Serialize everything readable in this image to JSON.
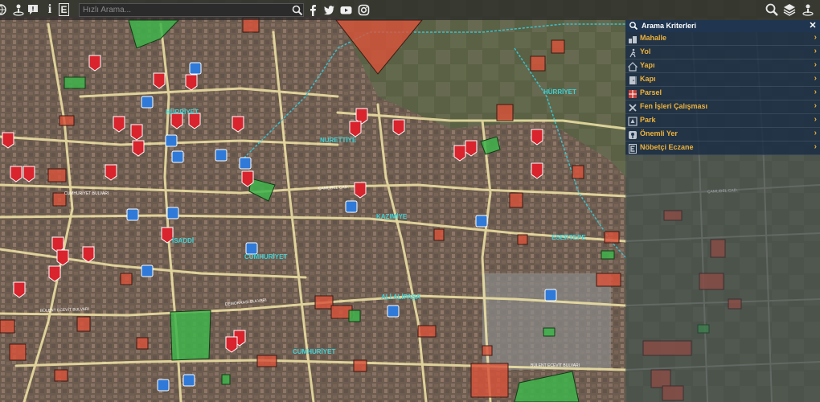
{
  "toolbar": {
    "icons": [
      "globe-icon",
      "location-pin-icon",
      "comment-icon",
      "info-icon",
      "pharmacy-e-icon"
    ],
    "info_glyph": "i",
    "pharmacy_glyph": "E",
    "search_placeholder": "Hızlı Arama...",
    "social": [
      "facebook-icon",
      "twitter-icon",
      "youtube-icon",
      "instagram-icon"
    ],
    "right_icons": [
      "search-zoom-icon",
      "layers-icon",
      "location-pin-icon"
    ]
  },
  "panel": {
    "title": "Arama Kriterleri",
    "items": [
      {
        "label": "Mahalle",
        "icon": "neighborhood-icon"
      },
      {
        "label": "Yol",
        "icon": "walker-icon"
      },
      {
        "label": "Yapı",
        "icon": "house-icon"
      },
      {
        "label": "Kapı",
        "icon": "door-icon"
      },
      {
        "label": "Parsel",
        "icon": "parcel-icon"
      },
      {
        "label": "Fen İşleri Çalışması",
        "icon": "tools-icon"
      },
      {
        "label": "Park",
        "icon": "park-icon"
      },
      {
        "label": "Önemli Yer",
        "icon": "important-place-icon"
      },
      {
        "label": "Nöbetçi Eczane",
        "icon": "pharmacy-icon"
      }
    ]
  },
  "map": {
    "neighborhoods": [
      "HÜRRİYET",
      "NURETTİYE",
      "KAZIMİYE",
      "ESERTEPE",
      "HÜRRİYET",
      "ALİ ALİPAŞA",
      "CUMHURİYET",
      "İSADDİ",
      "CUMHURİYET"
    ],
    "streets": [
      "ÇAMLIBEL CAD.",
      "ÇAMLIBEL CAD.",
      "BÜLENT ECEVİT BULVARI",
      "BÜLENT ECEVİT BULVARI",
      "DEMOKRASİ BULVARI",
      "CUMHURİYET BULVARI"
    ],
    "colors": {
      "parcel_red": "#d8533b",
      "park_green": "#3eb34a",
      "highway_marker": "#d9232d",
      "poi_marker": "#2f7ad8",
      "label_cyan": "#3fd2d6",
      "road": "#f2e6a6"
    }
  }
}
